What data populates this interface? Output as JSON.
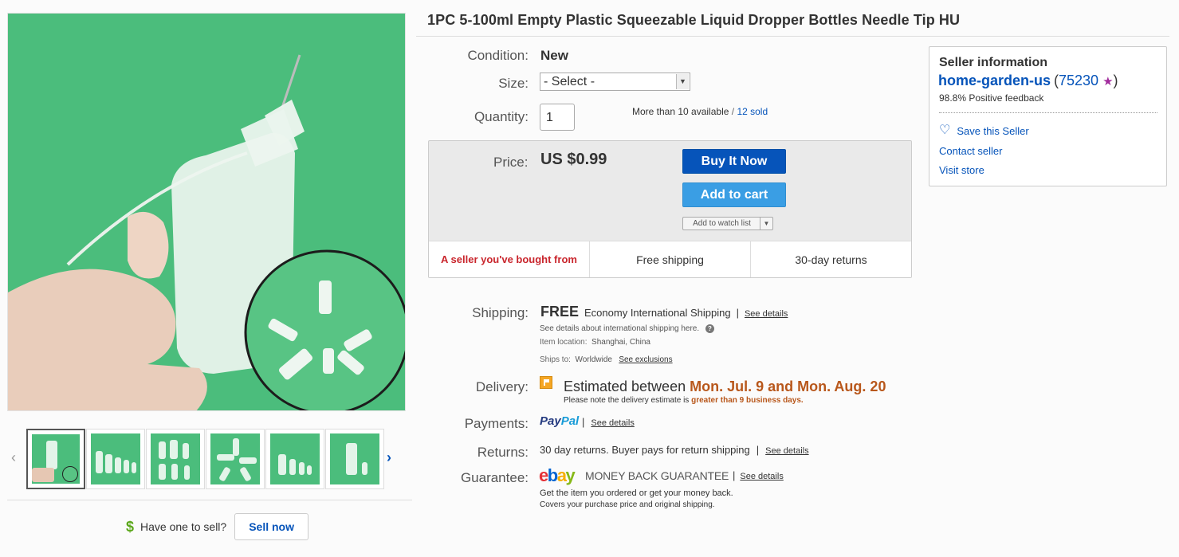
{
  "title": "1PC 5-100ml Empty Plastic Squeezable Liquid Dropper Bottles Needle Tip HU",
  "condition": {
    "label": "Condition:",
    "value": "New"
  },
  "size": {
    "label": "Size:",
    "selected": "- Select -"
  },
  "quantity": {
    "label": "Quantity:",
    "value": "1",
    "available": "More than 10 available",
    "separator": "/",
    "sold": "12 sold"
  },
  "price": {
    "label": "Price:",
    "value": "US $0.99",
    "buy_now": "Buy It Now",
    "add_to_cart": "Add to cart",
    "watch_list": "Add to watch list",
    "badges": [
      "A seller you've bought from",
      "Free shipping",
      "30-day returns"
    ]
  },
  "shipping": {
    "label": "Shipping:",
    "free": "FREE",
    "method": "Economy International Shipping",
    "pipe": "|",
    "see_details": "See details",
    "intl_note": "See details about international shipping here.",
    "location_key": "Item location:",
    "location_value": "Shanghai, China",
    "ships_to_key": "Ships to:",
    "ships_to_value": "Worldwide",
    "see_exclusions": "See exclusions"
  },
  "delivery": {
    "label": "Delivery:",
    "prefix": "Estimated between",
    "range": "Mon. Jul. 9 and Mon. Aug. 20",
    "note_prefix": "Please note the delivery estimate is",
    "note_highlight": "greater than 9 business days."
  },
  "payments": {
    "label": "Payments:",
    "paypal_a": "Pay",
    "paypal_b": "Pal",
    "pipe": "|",
    "see_details": "See details"
  },
  "returns": {
    "label": "Returns:",
    "text": "30 day returns. Buyer pays for return shipping",
    "pipe": "|",
    "see_details": "See details"
  },
  "guarantee": {
    "label": "Guarantee:",
    "logo": {
      "e": "e",
      "b": "b",
      "a": "a",
      "y": "y"
    },
    "mbg": "MONEY BACK GUARANTEE",
    "pipe": "|",
    "see_details": "See details",
    "line1": "Get the item you ordered or get your money back.",
    "line2": "Covers your purchase price and original shipping."
  },
  "seller": {
    "heading": "Seller information",
    "name": "home-garden-us",
    "open_paren": "(",
    "score": "75230",
    "close_paren": ")",
    "star": "★",
    "feedback": "98.8% Positive feedback",
    "save": "Save this Seller",
    "contact": "Contact seller",
    "visit": "Visit store"
  },
  "sell": {
    "prompt": "Have one to sell?",
    "button": "Sell now",
    "dollar": "$"
  },
  "gallery": {
    "prev": "‹",
    "next": "›"
  },
  "colors": {
    "brand_blue": "#0654ba",
    "image_green": "#4bbd7c",
    "delivery_orange": "#b8571b",
    "seller_red": "#c9252c"
  }
}
